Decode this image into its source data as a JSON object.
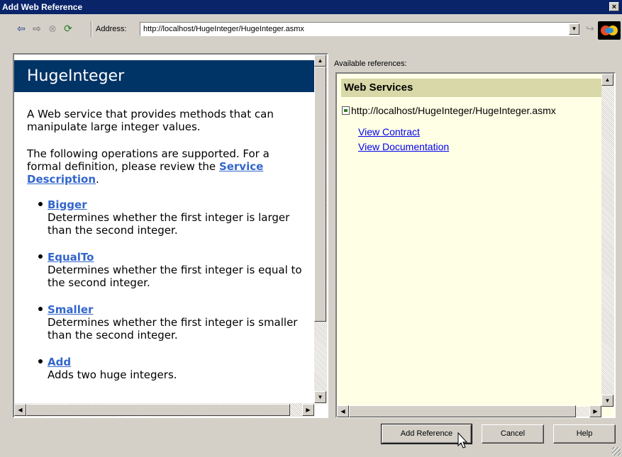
{
  "window": {
    "title": "Add Web Reference",
    "close_label": "×"
  },
  "toolbar": {
    "address_label": "Address:",
    "address_value": "http://localhost/HugeInteger/HugeInteger.asmx",
    "icons": [
      "back-icon",
      "forward-icon",
      "stop-icon",
      "refresh-icon",
      "go-icon",
      "logo-icon"
    ]
  },
  "left": {
    "title": "HugeInteger",
    "description": "A Web service that provides methods that can manipulate large integer values.",
    "operations_intro": "The following operations are supported. For a formal definition, please review the ",
    "service_description_link": "Service Description",
    "intro_end": ".",
    "operations": [
      {
        "name": "Bigger",
        "desc": "Determines whether the first integer is larger than the second integer."
      },
      {
        "name": "EqualTo",
        "desc": "Determines whether the first integer is equal to the second integer."
      },
      {
        "name": "Smaller",
        "desc": "Determines whether the first integer is smaller than the second integer."
      },
      {
        "name": "Add",
        "desc": "Adds two huge integers."
      }
    ]
  },
  "right": {
    "label": "Available references:",
    "header": "Web Services",
    "url": "http://localhost/HugeInteger/HugeInteger.asmx",
    "view_contract": "View Contract",
    "view_documentation": "View Documentation"
  },
  "buttons": {
    "add_reference": "Add Reference",
    "cancel": "Cancel",
    "help": "Help"
  }
}
